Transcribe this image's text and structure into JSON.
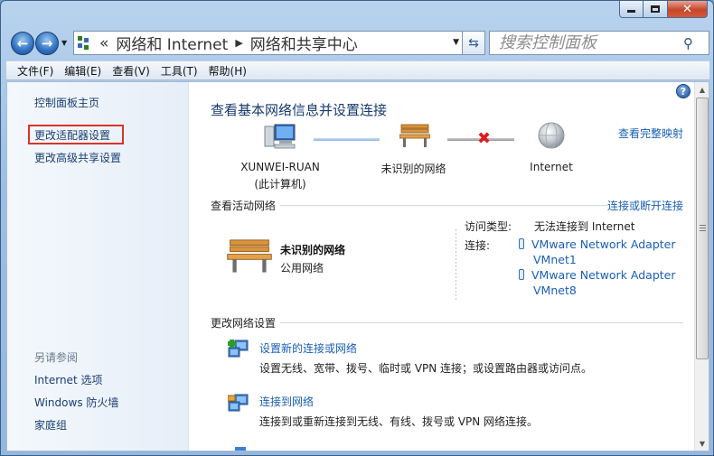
{
  "nav": {
    "back_icon": "arrow-left-icon",
    "forward_icon": "arrow-right-icon",
    "breadcrumb": [
      "网络和 Internet",
      "网络和共享中心"
    ],
    "breadcrumb_prefix": "«",
    "search_placeholder": "搜索控制面板"
  },
  "menu": [
    "文件(F)",
    "编辑(E)",
    "查看(V)",
    "工具(T)",
    "帮助(H)"
  ],
  "sidebar": {
    "links": [
      "控制面板主页",
      "更改适配器设置",
      "更改高级共享设置"
    ],
    "highlighted": "更改适配器设置",
    "see_also_heading": "另请参阅",
    "see_also": [
      "Internet 选项",
      "Windows 防火墙",
      "家庭组"
    ]
  },
  "main": {
    "title": "查看基本网络信息并设置连接",
    "full_map_link": "查看完整映射",
    "map": {
      "computer_name": "XUNWEI-RUAN",
      "computer_sub": "(此计算机)",
      "network": "未识别的网络",
      "internet": "Internet"
    },
    "active": {
      "heading": "查看活动网络",
      "toggle_link": "连接或断开连接",
      "network_name": "未识别的网络",
      "network_type": "公用网络",
      "access_type_label": "访问类型:",
      "access_type_value": "无法连接到 Internet",
      "connections_label": "连接:",
      "adapters": [
        {
          "line1": "VMware Network Adapter",
          "line2": "VMnet1"
        },
        {
          "line1": "VMware Network Adapter",
          "line2": "VMnet8"
        }
      ]
    },
    "change": {
      "heading": "更改网络设置",
      "tasks": [
        {
          "title": "设置新的连接或网络",
          "desc": "设置无线、宽带、拨号、临时或 VPN 连接；或设置路由器或访问点。"
        },
        {
          "title": "连接到网络",
          "desc": "连接到或重新连接到无线、有线、拨号或 VPN 网络连接。"
        }
      ]
    }
  },
  "colors": {
    "link": "#1a5fb4",
    "highlight_border": "#d9342b",
    "error_x": "#d91f1f"
  }
}
